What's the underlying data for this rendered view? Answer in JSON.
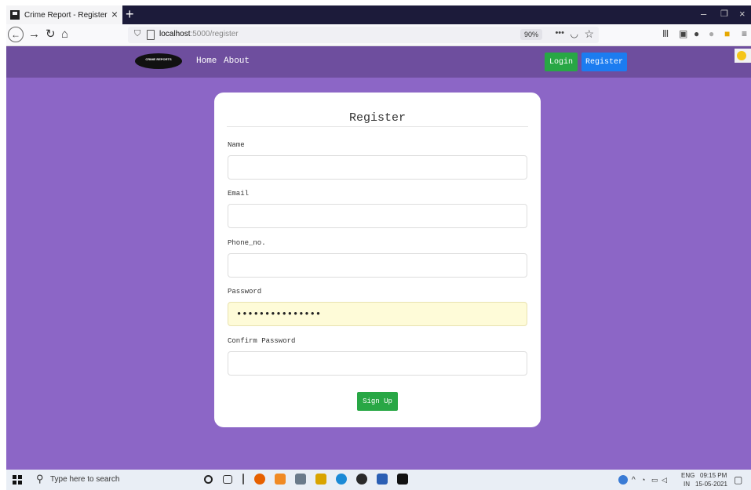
{
  "browser": {
    "tab_title": "Crime Report - Register",
    "tab_close": "×",
    "new_tab": "+",
    "url_host": "localhost",
    "url_path": ":5000/register",
    "zoom": "90%",
    "more": "•••",
    "min": "–",
    "restore": "❐",
    "close": "×"
  },
  "header": {
    "logo_text": "CRIME REPORTS",
    "nav_home": "Home",
    "nav_about": "About",
    "login_label": "Login",
    "register_label": "Register"
  },
  "form": {
    "title": "Register",
    "name_label": "Name",
    "name_value": "",
    "email_label": "Email",
    "email_value": "",
    "phone_label": "Phone_no.",
    "phone_value": "",
    "password_label": "Password",
    "password_value": "•••••••••••••••",
    "confirm_label": "Confirm Password",
    "confirm_value": "",
    "submit_label": "Sign Up"
  },
  "taskbar": {
    "search_placeholder": "Type here to search",
    "lang": "ENG",
    "region": "IN",
    "time": "09:15 PM",
    "date": "15-05-2021"
  },
  "colors": {
    "page_bg": "#8c66c6",
    "header_bg": "#6e4e9e",
    "login_btn": "#28a745",
    "register_btn": "#1c7cf0",
    "autofill_bg": "#fefbd8"
  }
}
